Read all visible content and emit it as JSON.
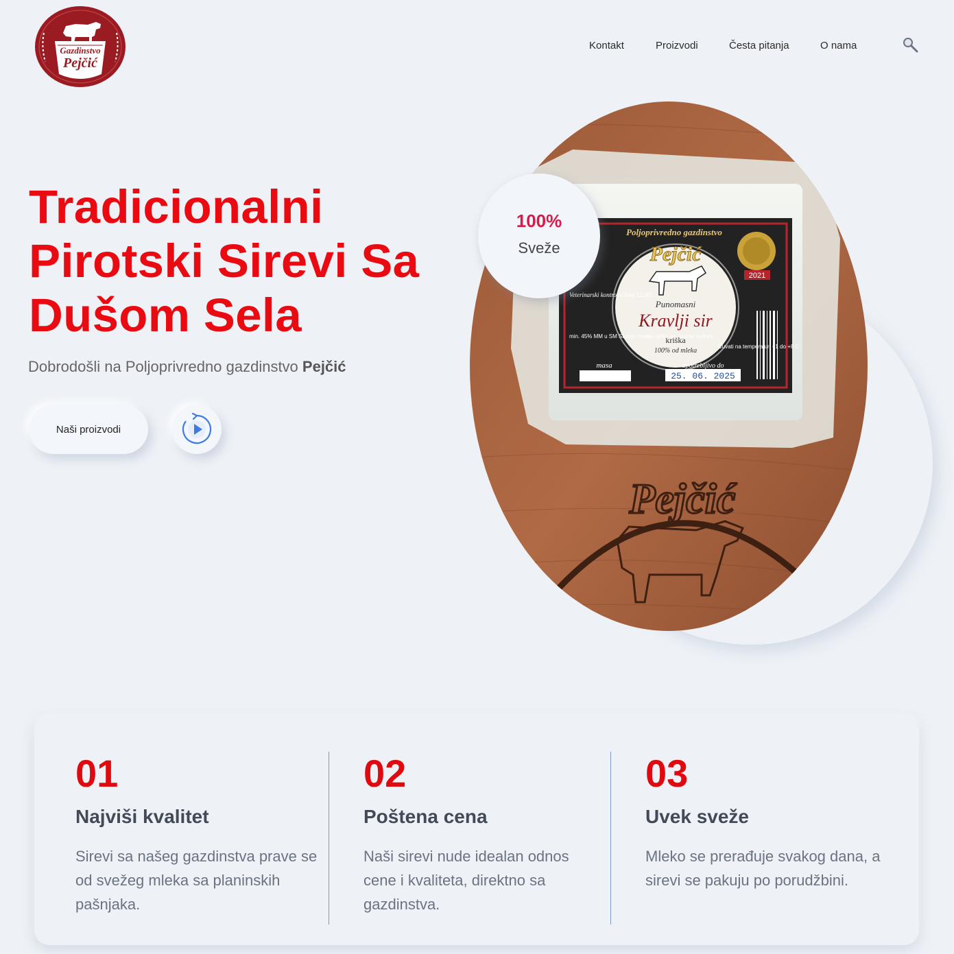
{
  "header": {
    "logo": {
      "line1": "Gazdinstvo",
      "line2": "Pejčić"
    },
    "nav": [
      {
        "label": "Kontakt"
      },
      {
        "label": "Proizvodi"
      },
      {
        "label": "Česta pitanja"
      },
      {
        "label": "O nama"
      }
    ],
    "search_icon": "search-icon"
  },
  "hero": {
    "title_lines": [
      "Tradicionalni",
      "Pirotski Sirevi Sa",
      "Dušom Sela"
    ],
    "subtitle_prefix": "Dobrodošli na Poljoprivredno gazdinstvo ",
    "subtitle_bold": "Pejčić",
    "cta_label": "Naši proizvodi",
    "play_icon": "play-icon",
    "badge": {
      "value": "100%",
      "label": "Sveže"
    },
    "image": {
      "package_header": "Poljoprivredno gazdinstvo",
      "brand": "Pejčić",
      "product_sub": "Punomasni",
      "product": "Kravlji sir",
      "variant": "kriška",
      "milk": "100% od mleka",
      "year": "2021",
      "best_before_label": "upotrebljivo do",
      "best_before": "25. 06. 2025",
      "vet_label": "Veterinarski kontrolni broj 12245",
      "composition": "min. 45% MM u SM Sastav: mleko, sirilo, so, starter kultura.",
      "mass_label": "masa",
      "storage": "Čuvati na temperaturi +1 do +8 C",
      "board_brand": "Pejčić"
    }
  },
  "features": [
    {
      "num": "01",
      "title": "Najviši kvalitet",
      "text": "Sirevi sa našeg gazdinstva prave se od svežeg mleka sa planinskih pašnjaka."
    },
    {
      "num": "02",
      "title": "Poštena cena",
      "text": "Naši sirevi nude idealan odnos cene i kvaliteta, direktno sa gazdinstva."
    },
    {
      "num": "03",
      "title": "Uvek sveže",
      "text": "Mleko se prerađuje svakog dana, a sirevi se pakuju po porudžbini."
    }
  ],
  "colors": {
    "accent_red": "#ea0a12",
    "logo_red": "#9a1b22",
    "background": "#eef2f7",
    "divider_blue": "#7b9ac8"
  }
}
